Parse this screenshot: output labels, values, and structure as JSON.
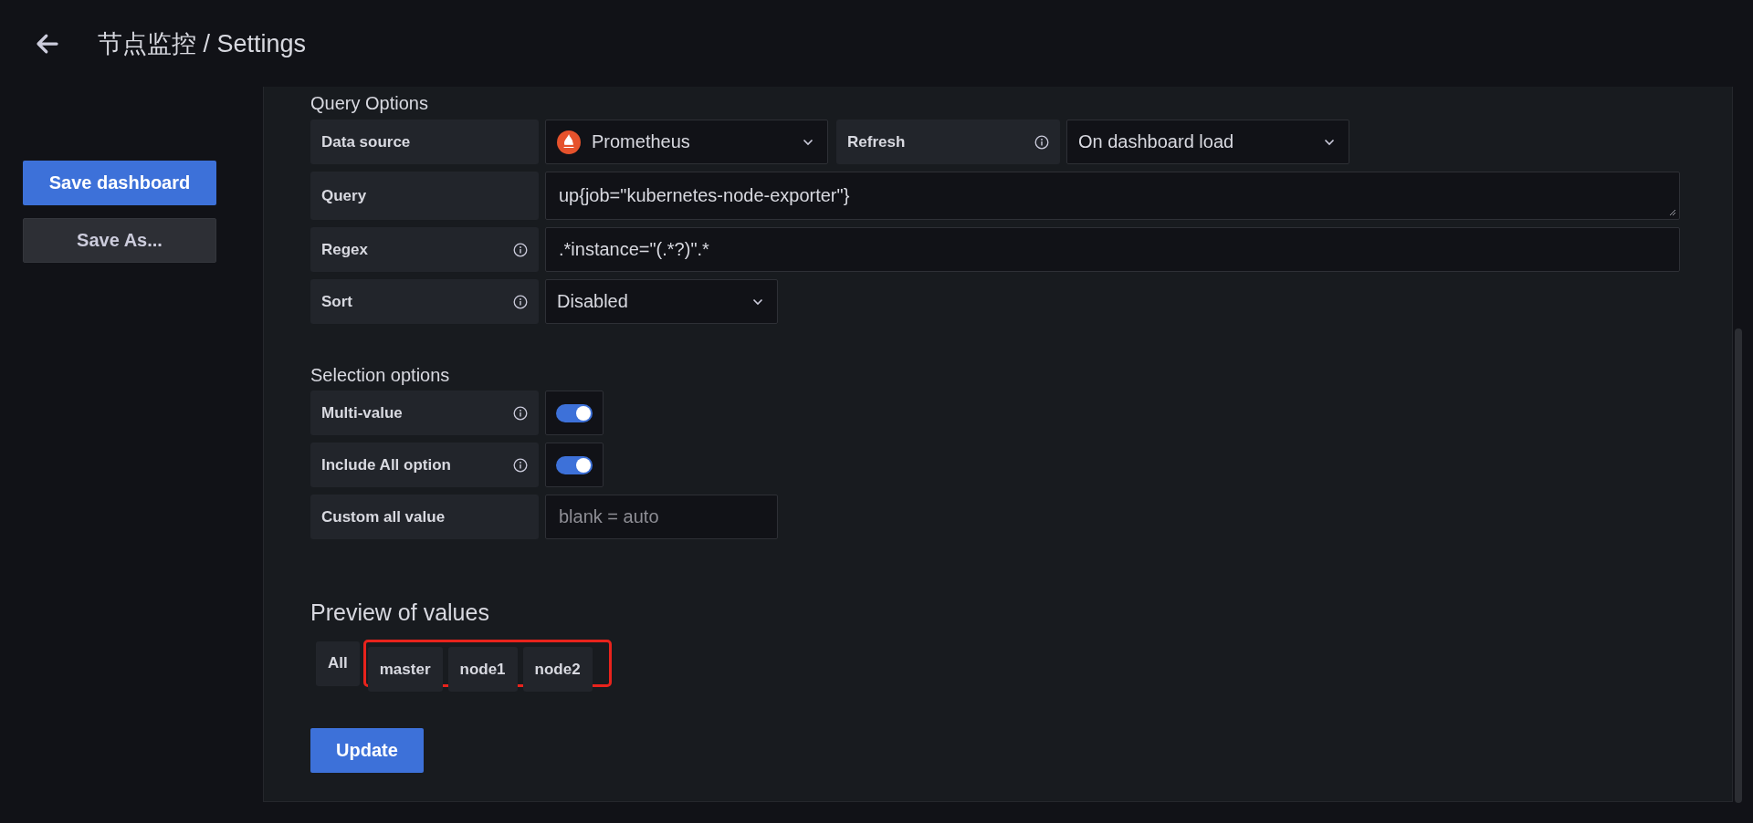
{
  "header": {
    "title": "节点监控 / Settings"
  },
  "sidebar": {
    "buttons": [
      {
        "label": "Save dashboard",
        "kind": "primary"
      },
      {
        "label": "Save As...",
        "kind": "secondary"
      }
    ]
  },
  "query_options": {
    "heading": "Query Options",
    "data_source": {
      "label": "Data source",
      "value": "Prometheus"
    },
    "refresh": {
      "label": "Refresh",
      "value": "On dashboard load"
    },
    "query": {
      "label": "Query",
      "value": "up{job=\"kubernetes-node-exporter\"}"
    },
    "regex": {
      "label": "Regex",
      "value": ".*instance=\"(.*?)\".*"
    },
    "sort": {
      "label": "Sort",
      "value": "Disabled"
    }
  },
  "selection_options": {
    "heading": "Selection options",
    "multi_value": {
      "label": "Multi-value",
      "on": true
    },
    "include_all": {
      "label": "Include All option",
      "on": true
    },
    "custom_all_value": {
      "label": "Custom all value",
      "placeholder": "blank = auto"
    }
  },
  "preview": {
    "heading": "Preview of values",
    "values": [
      {
        "label": "All",
        "highlighted": false
      },
      {
        "label": "master",
        "highlighted": true
      },
      {
        "label": "node1",
        "highlighted": true
      },
      {
        "label": "node2",
        "highlighted": true
      }
    ]
  },
  "update_button": {
    "label": "Update"
  }
}
